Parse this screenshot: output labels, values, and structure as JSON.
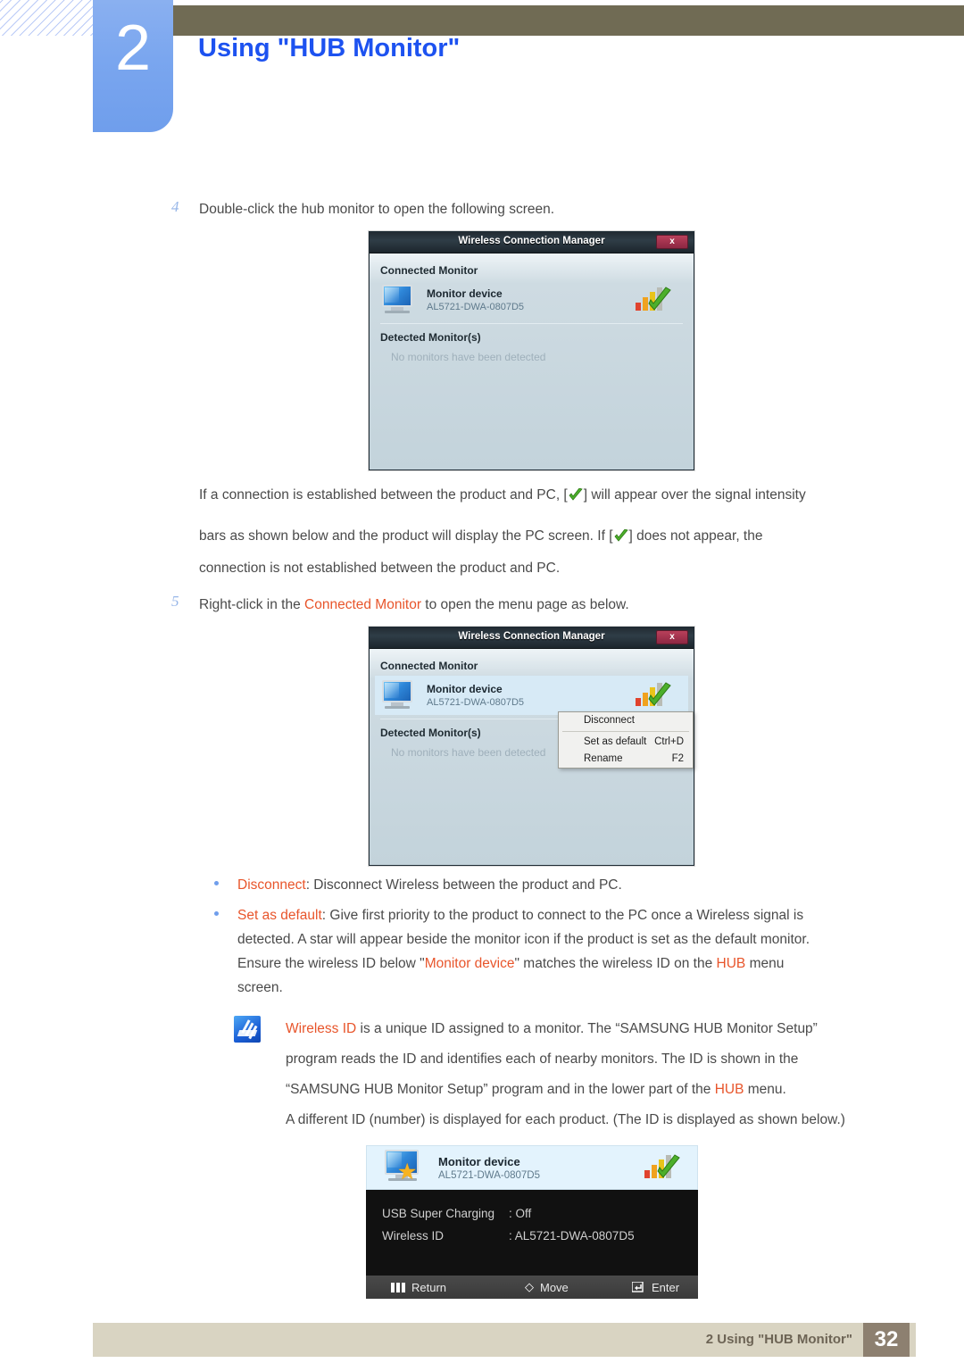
{
  "header": {
    "chapter_number": "2",
    "chapter_title": "Using \"HUB Monitor\""
  },
  "steps": [
    {
      "number": "4",
      "text": "Double-click the hub monitor to open the following screen."
    },
    {
      "number": "5",
      "text_before": "Right-click in the ",
      "highlight": "Connected Monitor",
      "text_after": " to open the menu page as below."
    }
  ],
  "paragraph": {
    "line1_a": "If a connection is established between the product and PC, [",
    "line1_b": "] will appear over the signal intensity",
    "line2_a": "bars as shown below and the product will display the PC screen. If [",
    "line2_b": "] does not appear, the",
    "line3": "connection is not established between the product and PC."
  },
  "dialog1": {
    "title": "Wireless Connection Manager",
    "close_label": "x",
    "connected_label": "Connected Monitor",
    "monitor_name": "Monitor device",
    "monitor_id": "AL5721-DWA-0807D5",
    "detected_label": "Detected Monitor(s)",
    "detected_empty": "No monitors have been detected"
  },
  "dialog2": {
    "title": "Wireless Connection Manager",
    "close_label": "x",
    "connected_label": "Connected Monitor",
    "monitor_name": "Monitor device",
    "monitor_id": "AL5721-DWA-0807D5",
    "detected_label": "Detected Monitor(s)",
    "detected_empty": "No monitors have been detected",
    "context_menu": [
      {
        "label": "Disconnect",
        "accel": ""
      },
      {
        "label": "Set as default",
        "accel": "Ctrl+D"
      },
      {
        "label": "Rename",
        "accel": "F2"
      }
    ]
  },
  "bullets": [
    {
      "term": "Disconnect",
      "body": ": Disconnect Wireless between the product and PC."
    },
    {
      "term": "Set as default",
      "body_line1": ": Give first priority to the product to connect to the PC once a Wireless signal is",
      "body_line2": "detected. A star will appear beside the monitor icon if the product is set as the default monitor.",
      "body_line3_a": "Ensure the wireless ID below \"",
      "body_line3_hl1": "Monitor device",
      "body_line3_b": "\" matches the wireless ID on the ",
      "body_line3_hl2": "HUB",
      "body_line3_c": " menu",
      "body_line4": "screen."
    }
  ],
  "note": {
    "icon": "memo-icon",
    "line1_hl": "Wireless ID",
    "line1": " is a unique ID assigned to a monitor. The “SAMSUNG HUB Monitor Setup”",
    "line2": "program reads the ID and identifies each of nearby monitors. The ID is shown in the",
    "line3_a": "“SAMSUNG HUB Monitor Setup” program and in the lower part of the ",
    "line3_hl": "HUB",
    "line3_b": " menu.",
    "line4": "A different ID (number) is displayed for each product. (The ID is displayed as shown below.)"
  },
  "osd": {
    "device_name": "Monitor device",
    "device_id": "AL5721-DWA-0807D5",
    "rows": [
      {
        "key": "USB Super Charging",
        "value": ": Off"
      },
      {
        "key": "Wireless ID",
        "value": ": AL5721-DWA-0807D5"
      }
    ],
    "actions": [
      {
        "icon": "return-icon",
        "label": "Return"
      },
      {
        "icon": "move-diamond-icon",
        "label": "Move"
      },
      {
        "icon": "enter-icon",
        "label": "Enter"
      }
    ]
  },
  "footer": {
    "text": "2 Using \"HUB Monitor\"",
    "page": "32"
  },
  "colors": {
    "accent_blue": "#1d52f0",
    "tab_blue": "#7aa6ef",
    "highlight_orange": "#e8552b",
    "header_brown": "#706b54",
    "footer_beige": "#d9d4c2",
    "footer_page_brown": "#8d8070"
  }
}
